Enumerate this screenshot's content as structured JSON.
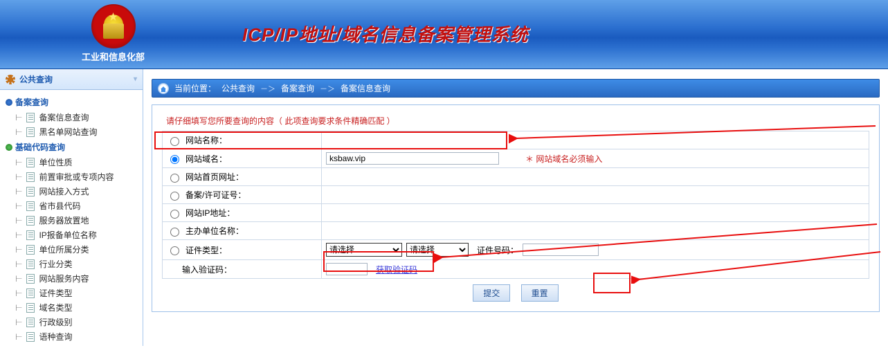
{
  "header": {
    "org": "工业和信息化部",
    "title": "ICP/IP地址/域名信息备案管理系统"
  },
  "sidebar": {
    "section": "公共查询",
    "group1": {
      "label": "备案查询",
      "items": [
        "备案信息查询",
        "黑名单网站查询"
      ]
    },
    "group2": {
      "label": "基础代码查询",
      "items": [
        "单位性质",
        "前置审批或专项内容",
        "网站接入方式",
        "省市县代码",
        "服务器放置地",
        "IP报备单位名称",
        "单位所属分类",
        "行业分类",
        "网站服务内容",
        "证件类型",
        "域名类型",
        "行政级别",
        "语种查询"
      ]
    }
  },
  "breadcrumb": {
    "label": "当前位置：",
    "a": "公共查询",
    "b": "备案查询",
    "c": "备案信息查询"
  },
  "form": {
    "hint": "请仔细填写您所要查询的内容（ 此项查询要求条件精确匹配 ）",
    "rows": {
      "site_name": {
        "label": "网站名称："
      },
      "domain": {
        "label": "网站域名：",
        "value": "ksbaw.vip",
        "note": "＊ 网站域名必须输入"
      },
      "homepage": {
        "label": "网站首页网址："
      },
      "license": {
        "label": "备案/许可证号："
      },
      "ip": {
        "label": "网站IP地址："
      },
      "sponsor": {
        "label": "主办单位名称："
      },
      "cert": {
        "label": "证件类型：",
        "sel_placeholder": "请选择",
        "cert_no_label": "证件号码："
      },
      "captcha": {
        "label": "输入验证码：",
        "get_label": "获取验证码"
      }
    },
    "buttons": {
      "submit": "提交",
      "reset": "重置"
    }
  }
}
